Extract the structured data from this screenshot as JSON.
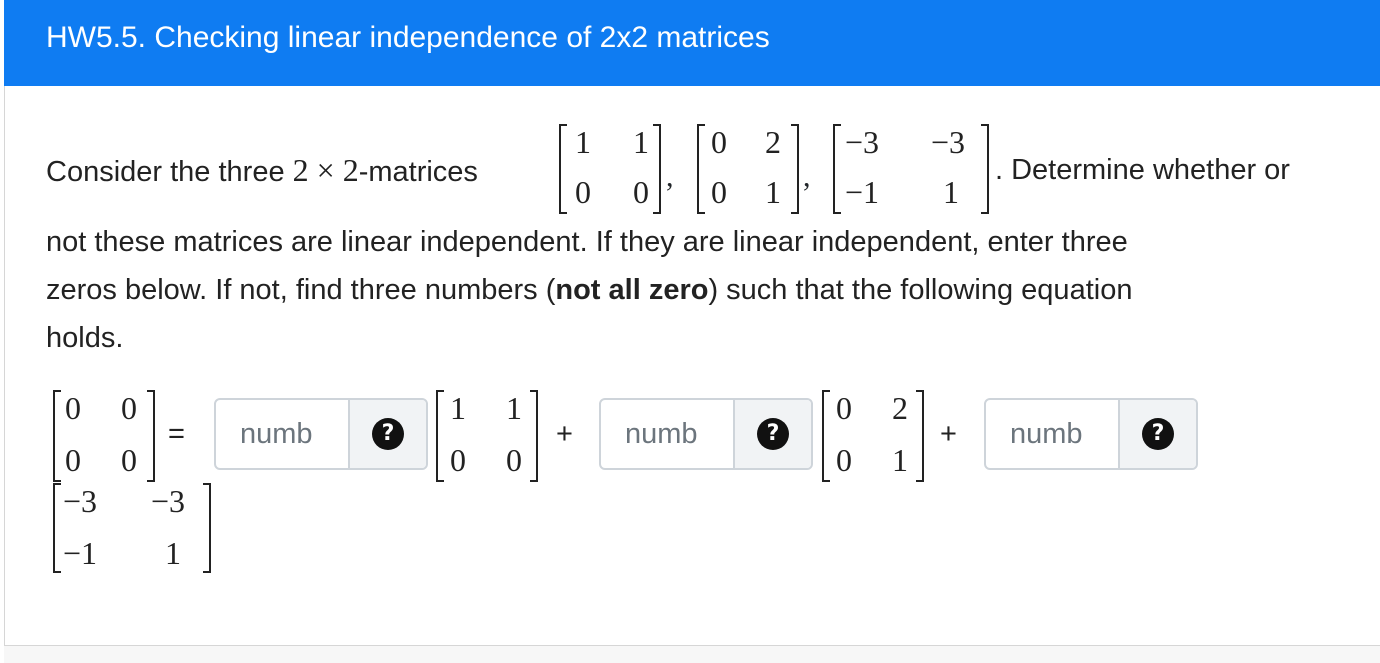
{
  "header": {
    "title": "HW5.5. Checking linear independence of 2x2 matrices"
  },
  "question": {
    "intro": "Consider the three",
    "size_expr": "2 × 2",
    "intro_suffix": "-matrices",
    "after_matrices": ". Determine whether or",
    "line2": "not these matrices are linear independent. If they are linear independent, enter three",
    "line3_a": "zeros below. If not, find three numbers (",
    "line3_bold": "not all zero",
    "line3_b": ") such that the following equation",
    "line4": "holds."
  },
  "matrices": {
    "A": [
      [
        "1",
        "1"
      ],
      [
        "0",
        "0"
      ]
    ],
    "B": [
      [
        "0",
        "2"
      ],
      [
        "0",
        "1"
      ]
    ],
    "C": [
      [
        "−3",
        "−3"
      ],
      [
        "−1",
        "1"
      ]
    ],
    "Z": [
      [
        "0",
        "0"
      ],
      [
        "0",
        "0"
      ]
    ]
  },
  "equation": {
    "equals": "=",
    "plus": "+"
  },
  "inputs": [
    {
      "placeholder": "numb",
      "help": "?"
    },
    {
      "placeholder": "numb",
      "help": "?"
    },
    {
      "placeholder": "numb",
      "help": "?"
    }
  ]
}
